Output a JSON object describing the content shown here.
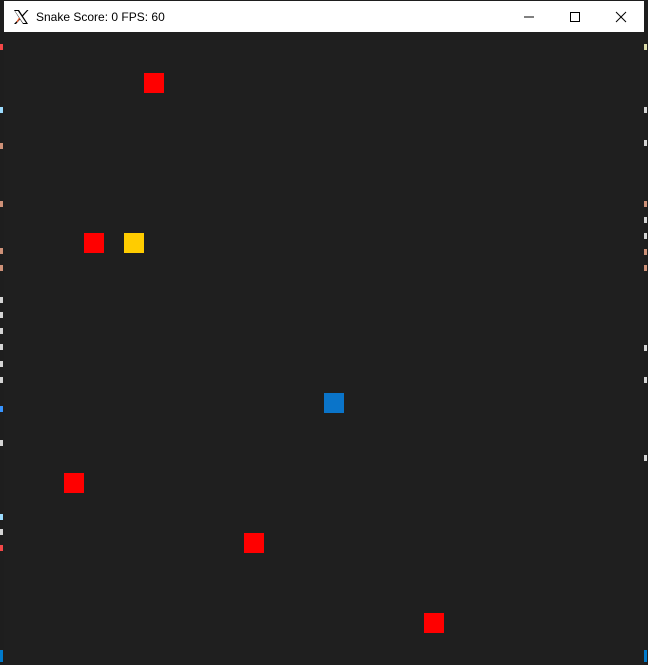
{
  "window": {
    "title": "Snake Score: 0 FPS: 60",
    "app_icon": "x-logo-icon",
    "controls": [
      "minimize-icon",
      "maximize-icon",
      "close-icon"
    ]
  },
  "game": {
    "score": 0,
    "fps": 60,
    "colors": {
      "background": "#1f1f1f",
      "food": "#ff0000",
      "snake_head": "#ffcc00",
      "obstacle": "#0a74c9"
    }
  }
}
